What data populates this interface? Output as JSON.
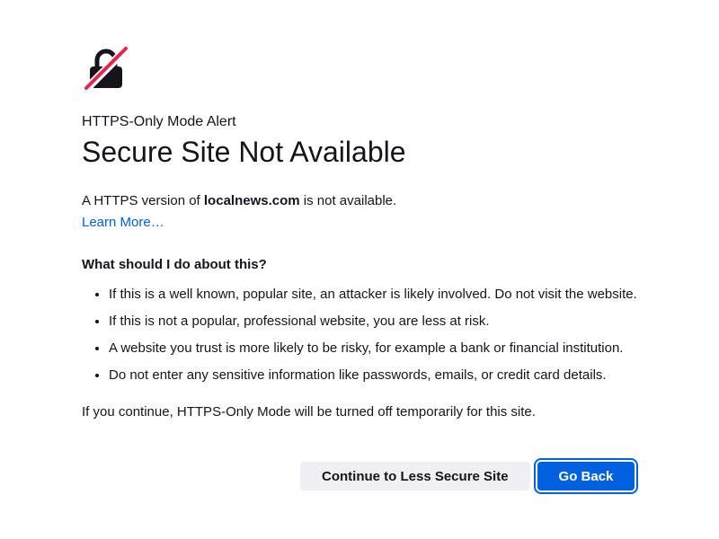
{
  "icons": {
    "lock": "lock-crossed-icon",
    "lock_color": "#15141a",
    "slash_color": "#e22850"
  },
  "header": {
    "subtitle": "HTTPS-Only Mode Alert",
    "title": "Secure Site Not Available"
  },
  "intro": {
    "prefix": "A HTTPS version of ",
    "domain": "localnews.com",
    "suffix": " is not available.",
    "learn_more": "Learn More…"
  },
  "advice": {
    "heading": "What should I do about this?",
    "items": [
      "If this is a well known, popular site, an attacker is likely involved. Do not visit the website.",
      "If this is not a popular, professional website, you are less at risk.",
      "A website you trust is more likely to be risky, for example a bank or financial institution.",
      "Do not enter any sensitive information like passwords, emails, or credit card details."
    ]
  },
  "continue_note": "If you continue, HTTPS-Only Mode will be turned off temporarily for this site.",
  "buttons": {
    "continue_label": "Continue to Less Secure Site",
    "go_back_label": "Go Back"
  },
  "colors": {
    "accent": "#0061e0",
    "text": "#15141a",
    "secondary_button": "#f0f0f4"
  }
}
